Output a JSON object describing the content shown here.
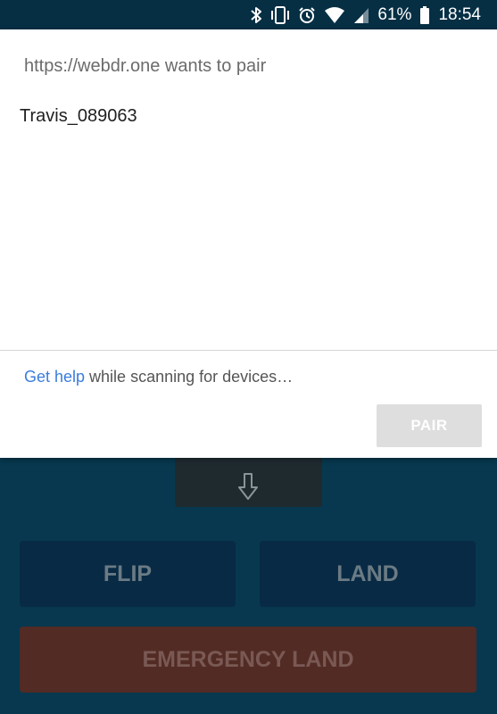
{
  "status_bar": {
    "battery_pct": "61%",
    "time": "18:54",
    "icons": [
      "bluetooth-icon",
      "vibrate-icon",
      "alarm-icon",
      "wifi-icon",
      "signal-icon",
      "battery-icon"
    ]
  },
  "dialog": {
    "title": "https://webdr.one wants to pair",
    "devices": [
      "Travis_089063"
    ],
    "footer": {
      "help_link": "Get help",
      "scanning_text": " while scanning for devices…"
    },
    "pair_label": "PAIR"
  },
  "app": {
    "arrow_icon": "arrow-down-icon",
    "flip_label": "FLIP",
    "land_label": "LAND",
    "emergency_label": "EMERGENCY LAND"
  },
  "colors": {
    "background": "#07384f",
    "status_bar": "#062f44",
    "link": "#3b7ddd",
    "pair_disabled": "#dedede",
    "emergency": "#522b24"
  }
}
